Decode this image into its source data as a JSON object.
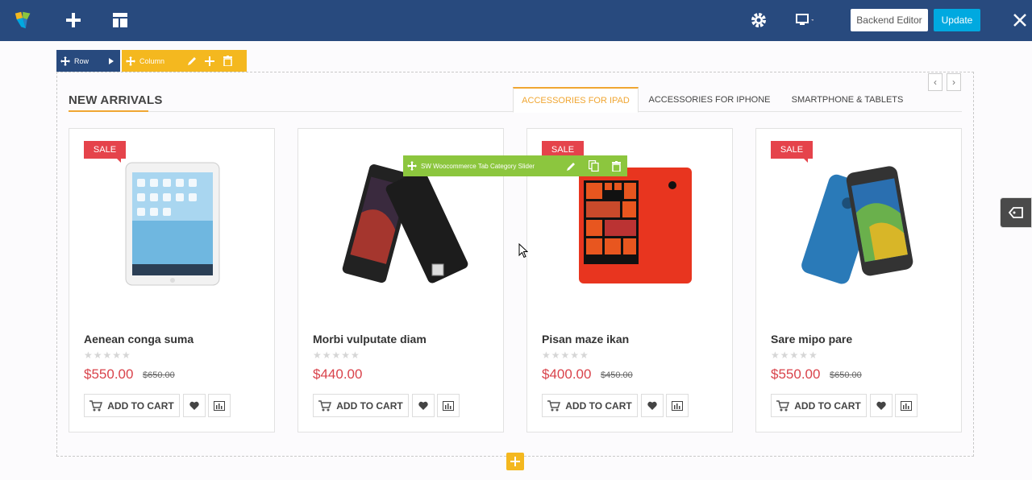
{
  "topbar": {
    "backend_editor": "Backend Editor",
    "update": "Update",
    "icons": [
      "logo-icon",
      "add-element-icon",
      "templates-icon",
      "settings-icon",
      "responsive-icon",
      "close-icon"
    ]
  },
  "row_controls": {
    "row_label": "Row",
    "column_label": "Column"
  },
  "section": {
    "title": "NEW ARRIVALS",
    "tabs": [
      {
        "label": "ACCESSORIES FOR IPAD",
        "active": true
      },
      {
        "label": "ACCESSORIES FOR IPHONE",
        "active": false
      },
      {
        "label": "SMARTPHONE & TABLETS",
        "active": false
      }
    ]
  },
  "element_toolbar": {
    "label": "SW Woocommerce Tab Category Slider"
  },
  "products": [
    {
      "name": "Aenean conga suma",
      "price": "$550.00",
      "old_price": "$650.00",
      "sale": "SALE",
      "stars": "★★★★★",
      "add_to_cart": "ADD TO CART"
    },
    {
      "name": "Morbi vulputate diam",
      "price": "$440.00",
      "old_price": "",
      "sale": "",
      "stars": "★★★★★",
      "add_to_cart": "ADD TO CART"
    },
    {
      "name": "Pisan maze ikan",
      "price": "$400.00",
      "old_price": "$450.00",
      "sale": "SALE",
      "stars": "★★★★★",
      "add_to_cart": "ADD TO CART"
    },
    {
      "name": "Sare mipo pare",
      "price": "$550.00",
      "old_price": "$650.00",
      "sale": "SALE",
      "stars": "★★★★★",
      "add_to_cart": "ADD TO CART"
    }
  ],
  "colors": {
    "topbar": "#284a7e",
    "accent": "#f0a632",
    "sale": "#e5434b",
    "update": "#00a9e0",
    "element_toolbar": "#8cc63e"
  }
}
